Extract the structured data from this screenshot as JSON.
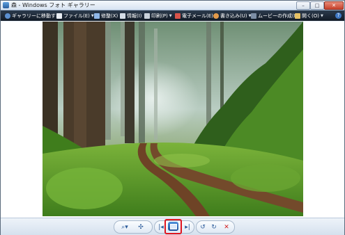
{
  "window": {
    "title": "森 - Windows フォト ギャラリー"
  },
  "toolbar": {
    "items": [
      {
        "label": "ギャラリーに移動する",
        "icon": "back-arrow-icon"
      },
      {
        "label": "ファイル(E)",
        "icon": "file-icon"
      },
      {
        "label": "修整(X)",
        "icon": "fix-icon"
      },
      {
        "label": "情報(I)",
        "icon": "info-icon"
      },
      {
        "label": "印刷(P)",
        "icon": "print-icon"
      },
      {
        "label": "電子メール(E)",
        "icon": "email-icon"
      },
      {
        "label": "書き込み(U)",
        "icon": "burn-icon"
      },
      {
        "label": "ムービーの作成(K)",
        "icon": "movie-icon"
      },
      {
        "label": "開く(O)",
        "icon": "open-icon"
      }
    ],
    "help_icon": "?"
  },
  "colors": {
    "toolbar": "#1c2836",
    "highlight": "#e0141e",
    "accent": "#2a5a9a"
  },
  "bottom": {
    "zoom_icon": "zoom-icon",
    "fit_icon": "actual-size-icon",
    "prev_icon": "previous-icon",
    "slideshow_icon": "slideshow-icon",
    "next_icon": "next-icon",
    "rotate_ccw_icon": "rotate-counterclockwise-icon",
    "rotate_cw_icon": "rotate-clockwise-icon",
    "delete_icon": "delete-icon"
  }
}
